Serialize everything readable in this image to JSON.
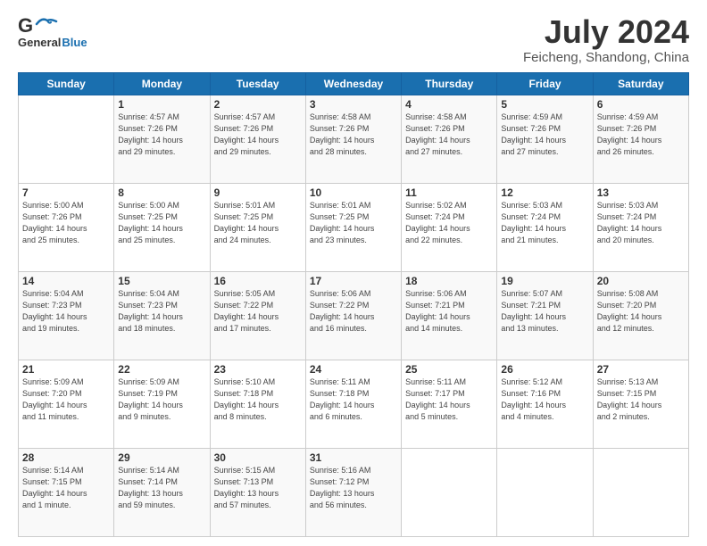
{
  "header": {
    "logo_general": "General",
    "logo_blue": "Blue",
    "month": "July 2024",
    "location": "Feicheng, Shandong, China"
  },
  "days_of_week": [
    "Sunday",
    "Monday",
    "Tuesday",
    "Wednesday",
    "Thursday",
    "Friday",
    "Saturday"
  ],
  "weeks": [
    [
      {
        "day": "",
        "info": ""
      },
      {
        "day": "1",
        "info": "Sunrise: 4:57 AM\nSunset: 7:26 PM\nDaylight: 14 hours\nand 29 minutes."
      },
      {
        "day": "2",
        "info": "Sunrise: 4:57 AM\nSunset: 7:26 PM\nDaylight: 14 hours\nand 29 minutes."
      },
      {
        "day": "3",
        "info": "Sunrise: 4:58 AM\nSunset: 7:26 PM\nDaylight: 14 hours\nand 28 minutes."
      },
      {
        "day": "4",
        "info": "Sunrise: 4:58 AM\nSunset: 7:26 PM\nDaylight: 14 hours\nand 27 minutes."
      },
      {
        "day": "5",
        "info": "Sunrise: 4:59 AM\nSunset: 7:26 PM\nDaylight: 14 hours\nand 27 minutes."
      },
      {
        "day": "6",
        "info": "Sunrise: 4:59 AM\nSunset: 7:26 PM\nDaylight: 14 hours\nand 26 minutes."
      }
    ],
    [
      {
        "day": "7",
        "info": "Sunrise: 5:00 AM\nSunset: 7:26 PM\nDaylight: 14 hours\nand 25 minutes."
      },
      {
        "day": "8",
        "info": "Sunrise: 5:00 AM\nSunset: 7:25 PM\nDaylight: 14 hours\nand 25 minutes."
      },
      {
        "day": "9",
        "info": "Sunrise: 5:01 AM\nSunset: 7:25 PM\nDaylight: 14 hours\nand 24 minutes."
      },
      {
        "day": "10",
        "info": "Sunrise: 5:01 AM\nSunset: 7:25 PM\nDaylight: 14 hours\nand 23 minutes."
      },
      {
        "day": "11",
        "info": "Sunrise: 5:02 AM\nSunset: 7:24 PM\nDaylight: 14 hours\nand 22 minutes."
      },
      {
        "day": "12",
        "info": "Sunrise: 5:03 AM\nSunset: 7:24 PM\nDaylight: 14 hours\nand 21 minutes."
      },
      {
        "day": "13",
        "info": "Sunrise: 5:03 AM\nSunset: 7:24 PM\nDaylight: 14 hours\nand 20 minutes."
      }
    ],
    [
      {
        "day": "14",
        "info": "Sunrise: 5:04 AM\nSunset: 7:23 PM\nDaylight: 14 hours\nand 19 minutes."
      },
      {
        "day": "15",
        "info": "Sunrise: 5:04 AM\nSunset: 7:23 PM\nDaylight: 14 hours\nand 18 minutes."
      },
      {
        "day": "16",
        "info": "Sunrise: 5:05 AM\nSunset: 7:22 PM\nDaylight: 14 hours\nand 17 minutes."
      },
      {
        "day": "17",
        "info": "Sunrise: 5:06 AM\nSunset: 7:22 PM\nDaylight: 14 hours\nand 16 minutes."
      },
      {
        "day": "18",
        "info": "Sunrise: 5:06 AM\nSunset: 7:21 PM\nDaylight: 14 hours\nand 14 minutes."
      },
      {
        "day": "19",
        "info": "Sunrise: 5:07 AM\nSunset: 7:21 PM\nDaylight: 14 hours\nand 13 minutes."
      },
      {
        "day": "20",
        "info": "Sunrise: 5:08 AM\nSunset: 7:20 PM\nDaylight: 14 hours\nand 12 minutes."
      }
    ],
    [
      {
        "day": "21",
        "info": "Sunrise: 5:09 AM\nSunset: 7:20 PM\nDaylight: 14 hours\nand 11 minutes."
      },
      {
        "day": "22",
        "info": "Sunrise: 5:09 AM\nSunset: 7:19 PM\nDaylight: 14 hours\nand 9 minutes."
      },
      {
        "day": "23",
        "info": "Sunrise: 5:10 AM\nSunset: 7:18 PM\nDaylight: 14 hours\nand 8 minutes."
      },
      {
        "day": "24",
        "info": "Sunrise: 5:11 AM\nSunset: 7:18 PM\nDaylight: 14 hours\nand 6 minutes."
      },
      {
        "day": "25",
        "info": "Sunrise: 5:11 AM\nSunset: 7:17 PM\nDaylight: 14 hours\nand 5 minutes."
      },
      {
        "day": "26",
        "info": "Sunrise: 5:12 AM\nSunset: 7:16 PM\nDaylight: 14 hours\nand 4 minutes."
      },
      {
        "day": "27",
        "info": "Sunrise: 5:13 AM\nSunset: 7:15 PM\nDaylight: 14 hours\nand 2 minutes."
      }
    ],
    [
      {
        "day": "28",
        "info": "Sunrise: 5:14 AM\nSunset: 7:15 PM\nDaylight: 14 hours\nand 1 minute."
      },
      {
        "day": "29",
        "info": "Sunrise: 5:14 AM\nSunset: 7:14 PM\nDaylight: 13 hours\nand 59 minutes."
      },
      {
        "day": "30",
        "info": "Sunrise: 5:15 AM\nSunset: 7:13 PM\nDaylight: 13 hours\nand 57 minutes."
      },
      {
        "day": "31",
        "info": "Sunrise: 5:16 AM\nSunset: 7:12 PM\nDaylight: 13 hours\nand 56 minutes."
      },
      {
        "day": "",
        "info": ""
      },
      {
        "day": "",
        "info": ""
      },
      {
        "day": "",
        "info": ""
      }
    ]
  ]
}
